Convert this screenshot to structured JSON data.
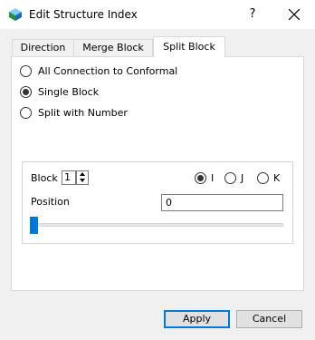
{
  "window": {
    "title": "Edit Structure Index",
    "help": "?"
  },
  "tabs": [
    "Direction",
    "Merge Block",
    "Split Block"
  ],
  "split_mode": {
    "options": [
      "All Connection to Conformal",
      "Single Block",
      "Split with Number"
    ],
    "selected": "Single Block"
  },
  "block": {
    "label": "Block",
    "value": "1"
  },
  "axis": {
    "options": [
      "I",
      "J",
      "K"
    ],
    "selected": "I"
  },
  "position": {
    "label": "Position",
    "value": "0",
    "slider_fraction": 0
  },
  "buttons": {
    "apply": "Apply",
    "cancel": "Cancel"
  },
  "colors": {
    "accent": "#0078d7"
  }
}
